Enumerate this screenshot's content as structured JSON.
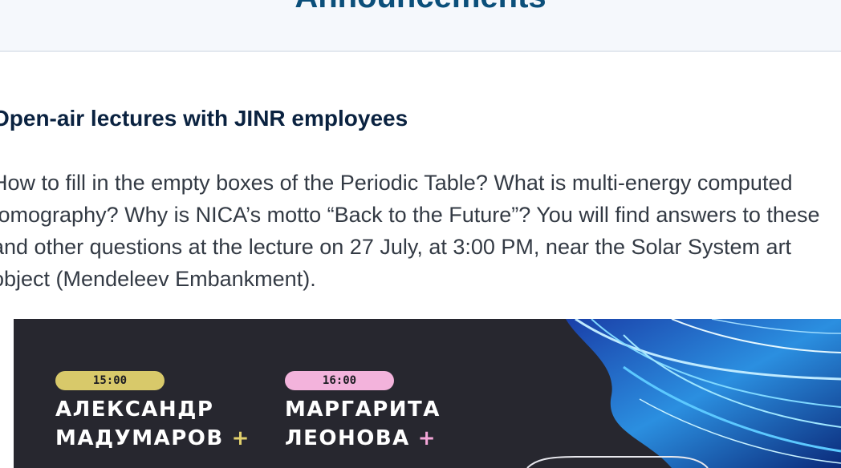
{
  "header": {
    "title": "Announcements"
  },
  "news": {
    "title": "Open-air lectures with JINR employees",
    "body": "How to fill in the empty boxes of the Periodic Table? What is multi-energy computed tomography? Why is NICA’s motto “Back to the Future”? You will find answers to these and other questions at the lecture on 27 July, at 3:00 PM, near the Solar System art object (Mendeleev Embankment)."
  },
  "banner": {
    "speakers": [
      {
        "time": "15:00",
        "first_name": "АЛЕКСАНДР",
        "last_name": "МАДУМАРОВ",
        "plus": "+",
        "pill_color": "#d8c96a",
        "plus_color": "#e0cf6c"
      },
      {
        "time": "16:00",
        "first_name": "МАРГАРИТА",
        "last_name": "ЛЕОНОВА",
        "plus": "+",
        "pill_color": "#f3b3dc",
        "plus_color": "#f4a6d8"
      }
    ]
  }
}
